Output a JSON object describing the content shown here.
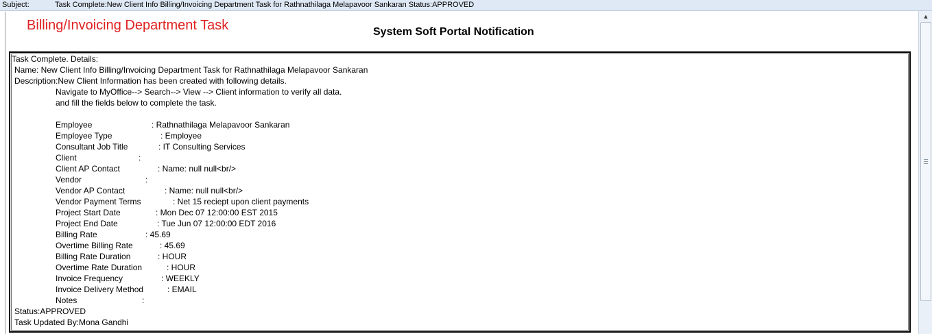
{
  "subject": {
    "label": "Subject:",
    "value": "Task Complete:New Client Info Billing/Invoicing Department Task for Rathnathilaga Melapavoor Sankaran Status:APPROVED"
  },
  "header": {
    "department_title": "Billing/Invoicing Department Task",
    "portal_title": "System Soft Portal Notification"
  },
  "details": {
    "intro": "Task Complete.  Details:",
    "name_line": "Name: New Client Info Billing/Invoicing Department Task for Rathnathilaga Melapavoor Sankaran",
    "description_line": "Description:New Client Information has been created with following details.",
    "instructions": [
      "Navigate to MyOffice--> Search--> View --> Client information to verify all data.",
      "and fill the fields below to complete the task."
    ],
    "fields": [
      {
        "label": "Employee",
        "value": ": Rathnathilaga Melapavoor Sankaran"
      },
      {
        "label": "Employee Type",
        "value": ": Employee"
      },
      {
        "label": "Consultant Job Title",
        "value": ": IT Consulting Services"
      },
      {
        "label": "Client",
        "value": ":"
      },
      {
        "label": "Client AP Contact",
        "value": ": Name: null null<br/>"
      },
      {
        "label": "Vendor",
        "value": ":"
      },
      {
        "label": "Vendor AP Contact",
        "value": ": Name: null null<br/>"
      },
      {
        "label": "Vendor Payment Terms",
        "value": ": Net 15 reciept upon client payments"
      },
      {
        "label": "Project Start Date",
        "value": ": Mon Dec 07 12:00:00 EST 2015"
      },
      {
        "label": "Project End Date",
        "value": ": Tue Jun 07 12:00:00 EDT 2016"
      },
      {
        "label": "Billing Rate",
        "value": ": 45.69"
      },
      {
        "label": "Overtime Billing Rate",
        "value": ": 45.69"
      },
      {
        "label": "Billing Rate Duration",
        "value": ": HOUR"
      },
      {
        "label": "Overtime Rate Duration",
        "value": ": HOUR"
      },
      {
        "label": "Invoice Frequency",
        "value": ": WEEKLY"
      },
      {
        "label": "Invoice Delivery Method",
        "value": ": EMAIL"
      },
      {
        "label": "Notes",
        "value": ":"
      }
    ],
    "status_line": "Status:APPROVED",
    "updated_by_line": "Task Updated By:Mona Gandhi"
  },
  "scrollbar": {
    "up_arrow_icon": "chevron-up-icon"
  }
}
